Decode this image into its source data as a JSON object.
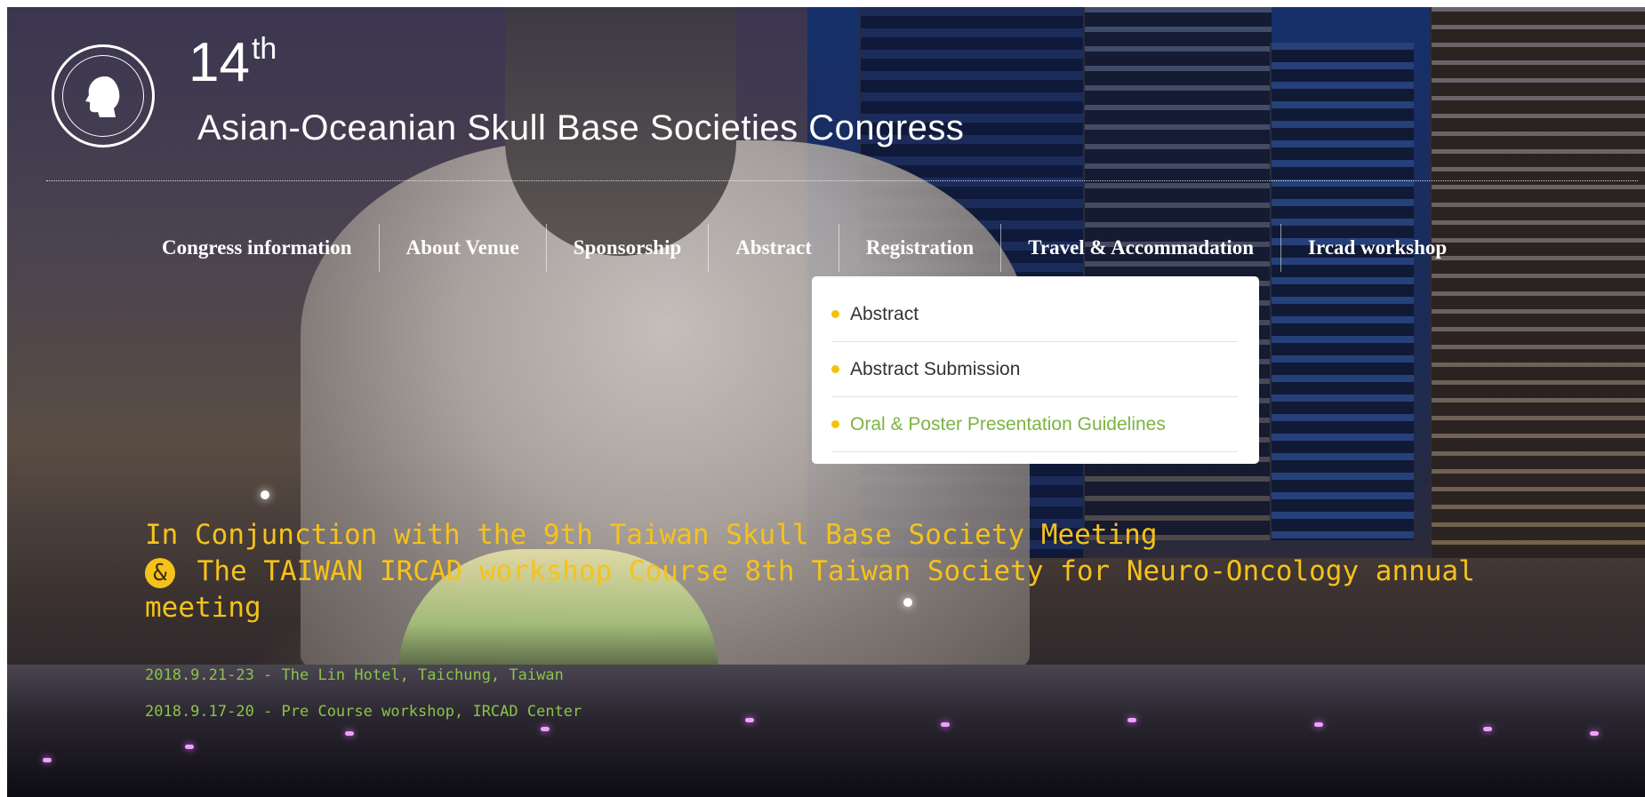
{
  "header": {
    "ordinal_number": "14",
    "ordinal_suffix": "th",
    "congress_title": "Asian-Oceanian Skull Base Societies Congress",
    "logo_icon": "society-logo-icon"
  },
  "nav": {
    "items": [
      {
        "label": "Congress information"
      },
      {
        "label": "About Venue"
      },
      {
        "label": "Sponsorship"
      },
      {
        "label": "Abstract"
      },
      {
        "label": "Registration"
      },
      {
        "label": "Travel & Accommadation"
      },
      {
        "label": "Ircad workshop"
      }
    ]
  },
  "dropdown": {
    "items": [
      {
        "label": "Abstract"
      },
      {
        "label": "Abstract Submission"
      },
      {
        "label": "Oral & Poster Presentation Guidelines"
      }
    ],
    "bullet_color": "#f4c20d",
    "highlight_color": "#7cb342"
  },
  "hero": {
    "line1": "In Conjunction with the 9th Taiwan Skull Base Society Meeting",
    "ampersand": "&",
    "line2": " The TAIWAN IRCAD workshop Course 8th Taiwan Society for Neuro-Oncology annual meeting",
    "date1": "2018.9.21-23  - The Lin Hotel, Taichung, Taiwan",
    "date2": "2018.9.17-20  - Pre Course workshop, IRCAD Center",
    "accent_color": "#f6c21a",
    "date_color": "#8bc34a"
  }
}
